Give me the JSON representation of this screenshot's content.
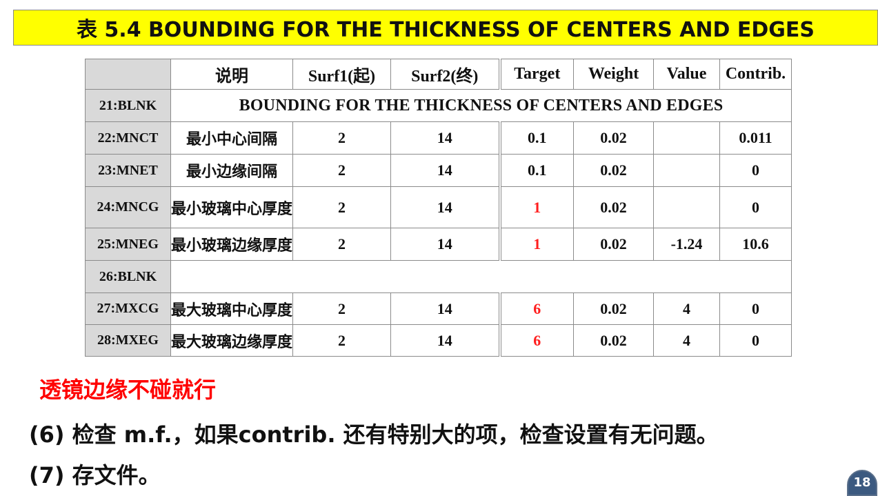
{
  "title": "表 5.4  BOUNDING FOR THE THICKNESS OF CENTERS AND EDGES",
  "table": {
    "headers": [
      "",
      "说明",
      "Surf1(起)",
      "Surf2(终)",
      "Target",
      "Weight",
      "Value",
      "Contrib."
    ],
    "row21": {
      "id": "21:BLNK",
      "text": "BOUNDING FOR THE THICKNESS OF CENTERS AND EDGES"
    },
    "rows": [
      {
        "id": "22:MNCT",
        "desc": "最小中心间隔",
        "surf1": "2",
        "surf2": "14",
        "target": "0.1",
        "weight": "0.02",
        "value": "",
        "contrib": "0.011"
      },
      {
        "id": "23:MNET",
        "desc": "最小边缘间隔",
        "surf1": "2",
        "surf2": "14",
        "target": "0.1",
        "weight": "0.02",
        "value": "",
        "contrib": "0"
      },
      {
        "id": "24:MNCG",
        "desc": "最小玻璃中心厚度",
        "surf1": "2",
        "surf2": "14",
        "target": "1",
        "weight": "0.02",
        "value": "",
        "contrib": "0"
      },
      {
        "id": "25:MNEG",
        "desc": "最小玻璃边缘厚度",
        "surf1": "2",
        "surf2": "14",
        "target": "1",
        "weight": "0.02",
        "value": "-1.24",
        "contrib": "10.6"
      }
    ],
    "row26": {
      "id": "26:BLNK"
    },
    "rows2": [
      {
        "id": "27:MXCG",
        "desc": "最大玻璃中心厚度",
        "surf1": "2",
        "surf2": "14",
        "target": "6",
        "weight": "0.02",
        "value": "4",
        "contrib": "0"
      },
      {
        "id": "28:MXEG",
        "desc": "最大玻璃边缘厚度",
        "surf1": "2",
        "surf2": "14",
        "target": "6",
        "weight": "0.02",
        "value": "4",
        "contrib": "0"
      }
    ]
  },
  "note": "透镜边缘不碰就行",
  "step6": "(6) 检查 m.f.，如果contrib. 还有特别大的项，检查设置有无问题。",
  "step7": "(7) 存文件。",
  "page_number": "18",
  "colors": {
    "title_bg": "#ffff00",
    "highlight": "#ff1e1e",
    "note": "#ff0000",
    "label_bg": "#d9d9d9"
  }
}
